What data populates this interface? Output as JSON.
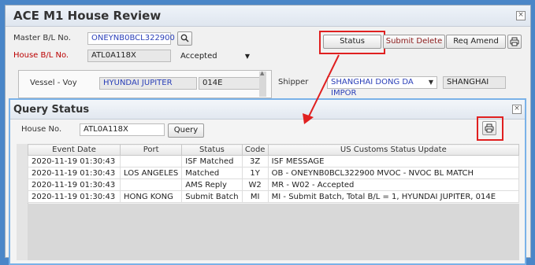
{
  "main": {
    "title": "ACE M1 House Review",
    "master_bl_label": "Master B/L No.",
    "master_bl_value": "ONEYNB0BCL322900",
    "house_bl_label": "House B/L No.",
    "house_bl_value": "ATL0A118X",
    "status_value": "Accepted",
    "status_button": "Status",
    "submit_delete_button": "Submit Delete",
    "req_amend_button": "Req Amend",
    "vessel_label": "Vessel - Voy",
    "vessel_value": "HYUNDAI JUPITER",
    "voyage_value": "014E",
    "shipper_label": "Shipper",
    "shipper_value": "SHANGHAI  DONG DA IMPOR",
    "shipper_city": "SHANGHAI"
  },
  "query": {
    "title": "Query Status",
    "house_no_label": "House No.",
    "house_no_value": "ATL0A118X",
    "query_button": "Query",
    "columns": [
      "Event Date",
      "Port",
      "Status",
      "Code",
      "US Customs Status Update"
    ],
    "rows": [
      {
        "date": "2020-11-19 01:30:43",
        "port": "",
        "status": "ISF Matched",
        "code": "3Z",
        "update": "ISF MESSAGE"
      },
      {
        "date": "2020-11-19 01:30:43",
        "port": "LOS ANGELES",
        "status": "Matched",
        "code": "1Y",
        "update": "OB - ONEYNB0BCL322900 MVOC - NVOC BL MATCH"
      },
      {
        "date": "2020-11-19 01:30:43",
        "port": "",
        "status": "AMS Reply",
        "code": "W2",
        "update": "MR - W02 - Accepted"
      },
      {
        "date": "2020-11-19 01:30:43",
        "port": "HONG KONG",
        "status": "Submit Batch",
        "code": "MI",
        "update": "MI - Submit Batch, Total B/L = 1, HYUNDAI JUPITER, 014E"
      }
    ]
  },
  "colors": {
    "background": "#4a86c8",
    "highlight": "#e02020",
    "link_blue": "#2a3fb8",
    "label_red": "#bb0000"
  },
  "icons": [
    "search-icon",
    "print-icon",
    "close-icon",
    "dropdown-arrow-icon",
    "annotation-arrow"
  ]
}
